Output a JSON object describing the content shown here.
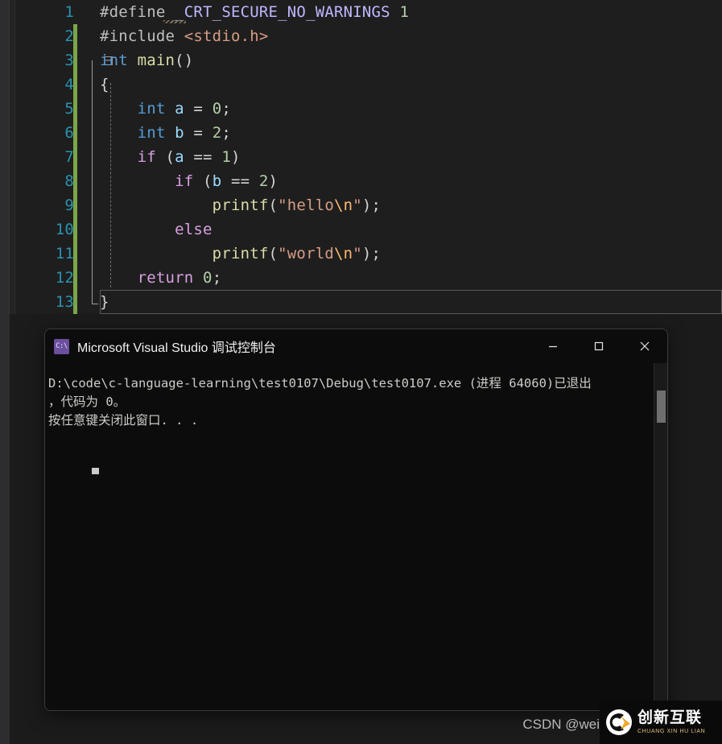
{
  "editor": {
    "name": "visual-studio-code-editor",
    "background": "#1e1e1e",
    "lines": [
      {
        "num": "1",
        "tokens": [
          {
            "t": "#define ",
            "c": "pre"
          },
          {
            "t": "_CRT_SECURE_NO_WARNINGS",
            "c": "macro"
          },
          {
            "t": " ",
            "c": "plain"
          },
          {
            "t": "1",
            "c": "num"
          }
        ]
      },
      {
        "num": "2",
        "tokens": [
          {
            "t": "#include ",
            "c": "pre"
          },
          {
            "t": "<stdio.h>",
            "c": "header"
          }
        ]
      },
      {
        "num": "3",
        "tokens": [
          {
            "t": "int",
            "c": "keyword"
          },
          {
            "t": " ",
            "c": "plain"
          },
          {
            "t": "main",
            "c": "func"
          },
          {
            "t": "()",
            "c": "punct"
          }
        ]
      },
      {
        "num": "4",
        "tokens": [
          {
            "t": "{",
            "c": "punct"
          }
        ]
      },
      {
        "num": "5",
        "tokens": [
          {
            "t": "    ",
            "c": "plain"
          },
          {
            "t": "int",
            "c": "keyword"
          },
          {
            "t": " ",
            "c": "plain"
          },
          {
            "t": "a",
            "c": "var"
          },
          {
            "t": " = ",
            "c": "punct"
          },
          {
            "t": "0",
            "c": "num"
          },
          {
            "t": ";",
            "c": "punct"
          }
        ]
      },
      {
        "num": "6",
        "tokens": [
          {
            "t": "    ",
            "c": "plain"
          },
          {
            "t": "int",
            "c": "keyword"
          },
          {
            "t": " ",
            "c": "plain"
          },
          {
            "t": "b",
            "c": "var"
          },
          {
            "t": " = ",
            "c": "punct"
          },
          {
            "t": "2",
            "c": "num"
          },
          {
            "t": ";",
            "c": "punct"
          }
        ]
      },
      {
        "num": "7",
        "tokens": [
          {
            "t": "    ",
            "c": "plain"
          },
          {
            "t": "if",
            "c": "ctrl"
          },
          {
            "t": " (",
            "c": "punct"
          },
          {
            "t": "a",
            "c": "var"
          },
          {
            "t": " == ",
            "c": "punct"
          },
          {
            "t": "1",
            "c": "num"
          },
          {
            "t": ")",
            "c": "punct"
          }
        ]
      },
      {
        "num": "8",
        "tokens": [
          {
            "t": "        ",
            "c": "plain"
          },
          {
            "t": "if",
            "c": "ctrl"
          },
          {
            "t": " (",
            "c": "punct"
          },
          {
            "t": "b",
            "c": "var"
          },
          {
            "t": " == ",
            "c": "punct"
          },
          {
            "t": "2",
            "c": "num"
          },
          {
            "t": ")",
            "c": "punct"
          }
        ]
      },
      {
        "num": "9",
        "tokens": [
          {
            "t": "            ",
            "c": "plain"
          },
          {
            "t": "printf",
            "c": "func"
          },
          {
            "t": "(",
            "c": "punct"
          },
          {
            "t": "\"hello",
            "c": "str"
          },
          {
            "t": "\\n",
            "c": "esc"
          },
          {
            "t": "\"",
            "c": "str"
          },
          {
            "t": ");",
            "c": "punct"
          }
        ]
      },
      {
        "num": "10",
        "tokens": [
          {
            "t": "        ",
            "c": "plain"
          },
          {
            "t": "else",
            "c": "ctrl"
          }
        ]
      },
      {
        "num": "11",
        "tokens": [
          {
            "t": "            ",
            "c": "plain"
          },
          {
            "t": "printf",
            "c": "func"
          },
          {
            "t": "(",
            "c": "punct"
          },
          {
            "t": "\"world",
            "c": "str"
          },
          {
            "t": "\\n",
            "c": "esc"
          },
          {
            "t": "\"",
            "c": "str"
          },
          {
            "t": ");",
            "c": "punct"
          }
        ]
      },
      {
        "num": "12",
        "tokens": [
          {
            "t": "    ",
            "c": "plain"
          },
          {
            "t": "return",
            "c": "ctrl"
          },
          {
            "t": " ",
            "c": "plain"
          },
          {
            "t": "0",
            "c": "num"
          },
          {
            "t": ";",
            "c": "punct"
          }
        ]
      },
      {
        "num": "13",
        "tokens": [
          {
            "t": "}",
            "c": "punct"
          }
        ]
      }
    ],
    "fold_glyph": "−",
    "current_line": 13
  },
  "console": {
    "title": "Microsoft Visual Studio 调试控制台",
    "icon_label": "C:\\",
    "window_buttons": {
      "minimize": "Minimize",
      "maximize": "Maximize",
      "close": "Close"
    },
    "output_lines": [
      "D:\\code\\c-language-learning\\test0107\\Debug\\test0107.exe (进程 64060)已退出",
      "，代码为 0。",
      "按任意键关闭此窗口. . ."
    ]
  },
  "watermark": {
    "csdn": "CSDN @wei",
    "brand_cn": "创新互联",
    "brand_pinyin": "CHUANG XIN HU LIAN"
  }
}
